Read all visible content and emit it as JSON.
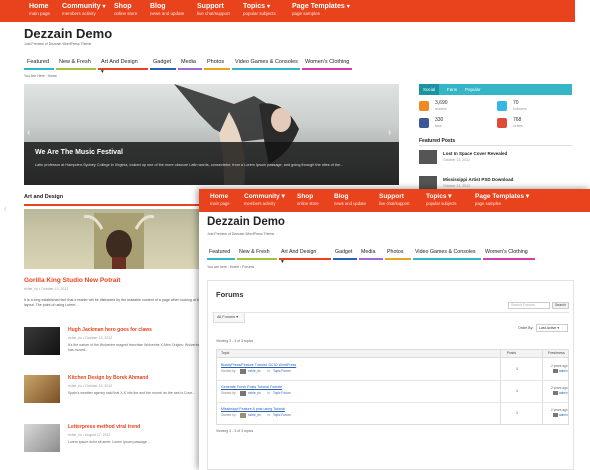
{
  "back_page": {
    "nav": [
      {
        "title": "Home",
        "sub": "main page"
      },
      {
        "title": "Community",
        "sub": "members activity",
        "caret": "▾"
      },
      {
        "title": "Shop",
        "sub": "online store"
      },
      {
        "title": "Blog",
        "sub": "news and update"
      },
      {
        "title": "Support",
        "sub": "live chat/support"
      },
      {
        "title": "Topics",
        "sub": "popular subjects",
        "caret": "▾"
      },
      {
        "title": "Page Templates",
        "sub": "page samples",
        "caret": "▾"
      }
    ],
    "site_title": "Dezzain Demo",
    "tagline": "Just Preview of Dezzain WordPress Theme",
    "menu": [
      {
        "label": "Featured",
        "color": "#35b6c6"
      },
      {
        "label": "New & Fresh",
        "color": "#9fc33c"
      },
      {
        "label": "Art And Design",
        "color": "#e8431d",
        "caret": "▾"
      },
      {
        "label": "Gadget",
        "color": "#2a62b5"
      },
      {
        "label": "Media",
        "color": "#a36ad1"
      },
      {
        "label": "Photos",
        "color": "#e8a51d"
      },
      {
        "label": "Video Games & Consoles",
        "color": "#35b6c6"
      },
      {
        "label": "Women's Clothing",
        "color": "#d63fa8"
      }
    ],
    "breadcrumb": "You Are Here : Home",
    "slider": {
      "title": "We Are The Music Festival",
      "text": "Latin professor at Hampden-Sydney College in Virginia, looked up one of the more obscure Latin words, consectetur, from a Lorem Ipsum passage, and going through the cites of the...",
      "prev": "‹",
      "next": "›"
    },
    "section_title": "Art and Design",
    "feature": {
      "title": "Gorilla King Studio New Potrait",
      "meta": "richie_ric  •  October 13, 2012",
      "excerpt": "It is a long established fact that a reader will be distracted by the readable content of a page when looking at its layout. The point of using Lorem..."
    },
    "posts": [
      {
        "title": "Hugh Jackman hero goes for claws",
        "meta": "richie_ric  •  October 13, 2012",
        "excerpt": "It's the nature of the Wolverine magnet franchise Wolverine X-Men Origins: Wolverine has moved..."
      },
      {
        "title": "Kitchen Design by Borek Ahmand",
        "meta": "richie_ric  •  October 13, 2012",
        "excerpt": "Spain's weather agency said that X-K hits the and the rooms' as the sea is Cove..."
      },
      {
        "title": "Letterpress method viral trend",
        "meta": "richie_ric  •  August 17, 2012",
        "excerpt": "Lorem ipsum dolor sit amet, Lorem Ipsum passage..."
      }
    ],
    "sidebar": {
      "tabs": [
        "Social",
        "Fans",
        "Popular"
      ],
      "social": [
        {
          "count": "3,690",
          "label": "readers",
          "color": "#f08a24"
        },
        {
          "count": "70",
          "label": "followers",
          "color": "#35b6e6"
        },
        {
          "count": "330",
          "label": "fans",
          "color": "#3b5998"
        },
        {
          "count": "768",
          "label": "circles",
          "color": "#dd4b39"
        }
      ],
      "featured_heading": "Featured Posts",
      "featured": [
        {
          "title": "Lost In Space Cover Revealed",
          "date": "October 13, 2012"
        },
        {
          "title": "Mississippi Artist PSD Download",
          "date": "October 13, 2012"
        }
      ]
    }
  },
  "front_page": {
    "nav": [
      {
        "title": "Home",
        "sub": "main page"
      },
      {
        "title": "Community",
        "sub": "members activity",
        "caret": "▾"
      },
      {
        "title": "Shop",
        "sub": "online store"
      },
      {
        "title": "Blog",
        "sub": "news and update"
      },
      {
        "title": "Support",
        "sub": "live chat/support"
      },
      {
        "title": "Topics",
        "sub": "popular subjects",
        "caret": "▾"
      },
      {
        "title": "Page Templates",
        "sub": "page samples",
        "caret": "▾"
      }
    ],
    "site_title": "Dezzain Demo",
    "tagline": "Just Preview of Dezzain WordPress Theme",
    "menu": [
      {
        "label": "Featured",
        "color": "#35b6c6"
      },
      {
        "label": "New & Fresh",
        "color": "#9fc33c"
      },
      {
        "label": "Art And Design",
        "color": "#e8431d",
        "caret": "▾"
      },
      {
        "label": "Gadget",
        "color": "#2a62b5"
      },
      {
        "label": "Media",
        "color": "#a36ad1"
      },
      {
        "label": "Photos",
        "color": "#e8a51d"
      },
      {
        "label": "Video Games & Consoles",
        "color": "#35b6c6"
      },
      {
        "label": "Women's Clothing",
        "color": "#d63fa8"
      }
    ],
    "breadcrumb": "You are here : Home › Forums",
    "forums": {
      "title": "Forums",
      "search_placeholder": "Search Forums",
      "search_button": "Search",
      "tab_all": "All Forums",
      "order_label": "Order By:",
      "order_value": "Last Active",
      "viewing_top": "Viewing 3 - 3 of 3 topics",
      "viewing_bottom": "Viewing 3 - 3 of 3 topics",
      "headers": {
        "topic": "Topic",
        "posts": "Posts",
        "freshness": "Freshness"
      },
      "rows": [
        {
          "name": "BuddyPress/Feature Tutorial: DCIO WordPress",
          "started": "Started by:",
          "author": "richie_ric",
          "in": "in:",
          "forum": "Topic Forum",
          "posts": "1",
          "fresh": "2 years ago",
          "fresh_user": "admin"
        },
        {
          "name": "Generate Fresh Posts Tutorial Fortnite",
          "started": "Started by:",
          "author": "richie_ric",
          "in": "in:",
          "forum": "Topic Forum",
          "posts": "1",
          "fresh": "2 years ago",
          "fresh_user": "admin"
        },
        {
          "name": "Mississippi Feature A post using Tutorial",
          "started": "Started by:",
          "author": "richie_ric",
          "in": "in:",
          "forum": "Topic Forum",
          "posts": "1",
          "fresh": "2 years ago",
          "fresh_user": "admin"
        }
      ]
    }
  },
  "colors": {
    "accent": "#e8431d",
    "teal": "#35b6c6",
    "link": "#2a62b5"
  }
}
